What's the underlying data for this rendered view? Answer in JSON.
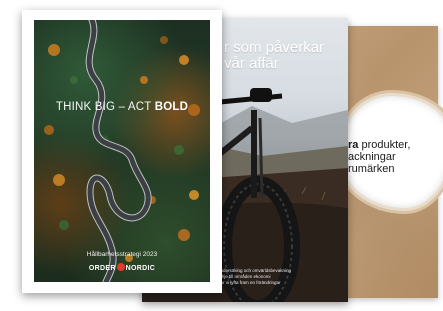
{
  "brochures": {
    "front": {
      "tagline_regular": "THINK BIG – ACT ",
      "tagline_bold": "BOLD",
      "subtitle": "Hållbarhetsstrategi 2023",
      "logo_left": "ORDER",
      "logo_right": "NORDIC"
    },
    "middle": {
      "headline_line1": "r som påverkar",
      "headline_line2": "vår affär",
      "small_text_line1": "undersöking och omvärldsbevakning",
      "small_text_line2": "ryhje till områden ekonomi",
      "small_text_line3": "har vi lyfta fram en förändringar"
    },
    "back": {
      "line1_strong": "ra",
      "line1_rest": " produkter,",
      "line2": "ackningar",
      "line3": "rumärken"
    }
  },
  "colors": {
    "page_background": "#ffffff",
    "logo_mark": "#e23b2e",
    "kraft": "#c6a57f"
  }
}
